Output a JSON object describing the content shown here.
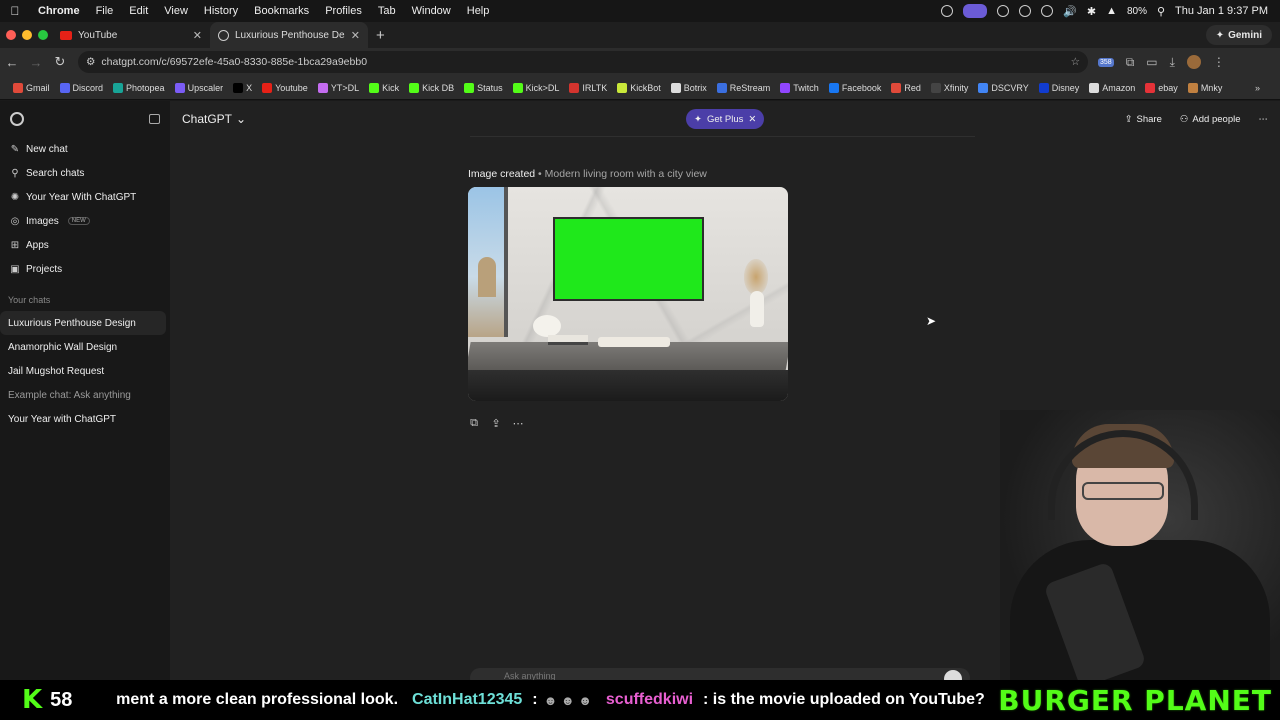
{
  "menubar": {
    "app": "Chrome",
    "items": [
      "File",
      "Edit",
      "View",
      "History",
      "Bookmarks",
      "Profiles",
      "Tab",
      "Window",
      "Help"
    ],
    "battery": "80%",
    "datetime": "Thu Jan 1  9:37 PM"
  },
  "tabs": [
    {
      "title": "YouTube",
      "icon": "youtube-icon"
    },
    {
      "title": "Luxurious Penthouse Design",
      "icon": "chatgpt-icon"
    }
  ],
  "gemini_label": "Gemini",
  "url": "chatgpt.com/c/69572efe-45a0-8330-885e-1bca29a9ebb0",
  "bookmarks": [
    "Gmail",
    "Discord",
    "Photopea",
    "Upscaler",
    "X",
    "Youtube",
    "YT>DL",
    "Kick",
    "Kick DB",
    "Status",
    "Kick>DL",
    "IRLTK",
    "KickBot",
    "Botrix",
    "ReStream",
    "Twitch",
    "Facebook",
    "Red",
    "Xfinity",
    "DSCVRY",
    "Disney",
    "Amazon",
    "ebay",
    "Mnky"
  ],
  "sidebar": {
    "items": [
      {
        "label": "New chat",
        "icon": "edit-icon"
      },
      {
        "label": "Search chats",
        "icon": "search-icon"
      },
      {
        "label": "Your Year With ChatGPT",
        "icon": "sparkle-icon"
      },
      {
        "label": "Images",
        "icon": "image-icon",
        "badge": "NEW"
      },
      {
        "label": "Apps",
        "icon": "grid-icon"
      },
      {
        "label": "Projects",
        "icon": "folder-icon"
      }
    ],
    "section_title": "Your chats",
    "chats": [
      "Luxurious Penthouse Design",
      "Anamorphic Wall Design",
      "Jail Mugshot Request",
      "Example chat: Ask anything",
      "Your Year with ChatGPT"
    ]
  },
  "header": {
    "model": "ChatGPT",
    "get_plus": "Get Plus",
    "share": "Share",
    "add_people": "Add people"
  },
  "message": {
    "caption_main": "Image created",
    "caption_sub": "Modern living room with a city view"
  },
  "composer": {
    "placeholder": "Ask anything"
  },
  "ticker": {
    "viewers": "58",
    "msg_fragment": "ment a more clean professional look.",
    "user1": "CatInHat12345",
    "user1_text": ":",
    "user2": "scuffedkiwi",
    "user2_text": ": is the movie uploaded on YouTube?",
    "brand": "BURGER PLANET"
  },
  "colors": {
    "accent_purple": "#4b3ea8",
    "kick_green": "#53fc18",
    "green_screen": "#1fe81b"
  }
}
